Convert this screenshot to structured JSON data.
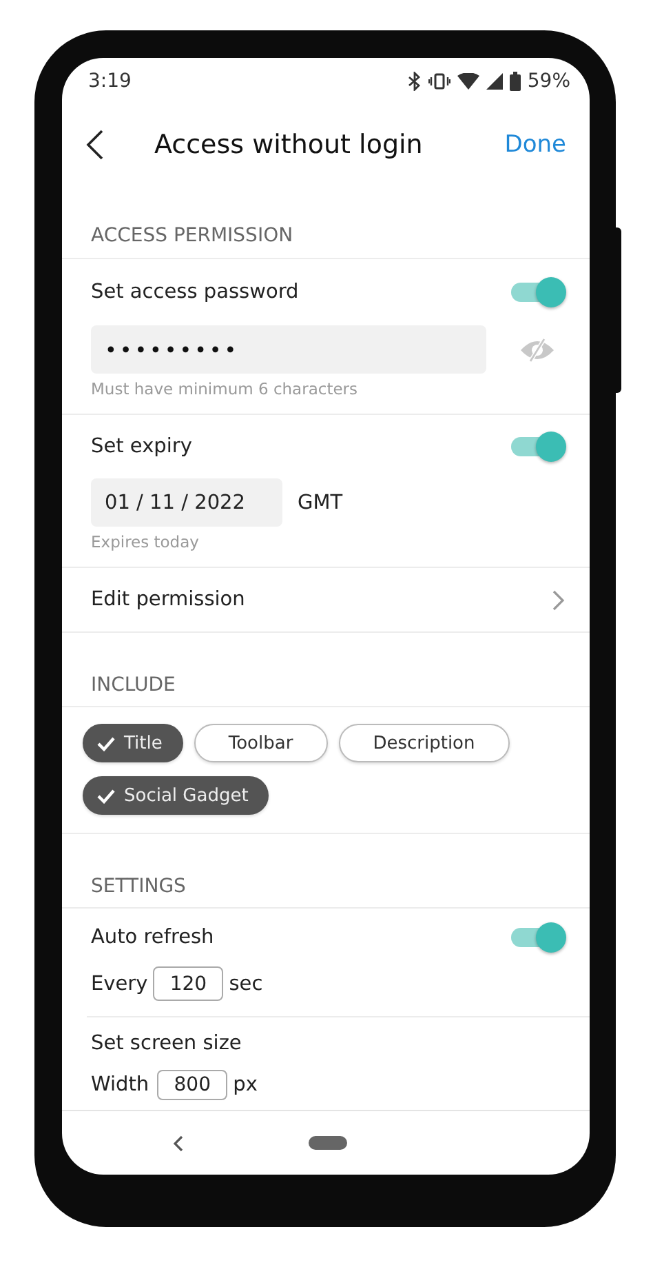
{
  "status_bar": {
    "time": "3:19",
    "battery": "59%"
  },
  "header": {
    "title": "Access without login",
    "done": "Done"
  },
  "access_permission": {
    "heading": "ACCESS PERMISSION",
    "password": {
      "label": "Set access password",
      "on": true,
      "value": "•••••••••",
      "hint": "Must have minimum 6 characters"
    },
    "expiry": {
      "label": "Set expiry",
      "on": true,
      "date": "01 / 11 / 2022",
      "timezone": "GMT",
      "hint": "Expires today"
    },
    "edit_permission": {
      "label": "Edit permission"
    }
  },
  "include": {
    "heading": "INCLUDE",
    "chips": [
      {
        "label": "Title",
        "selected": true
      },
      {
        "label": "Toolbar",
        "selected": false
      },
      {
        "label": "Description",
        "selected": false
      },
      {
        "label": "Social Gadget",
        "selected": true
      }
    ]
  },
  "settings": {
    "heading": "SETTINGS",
    "auto_refresh": {
      "label": "Auto refresh",
      "on": true,
      "prefix": "Every",
      "value": "120",
      "unit": "sec"
    },
    "screen_size": {
      "label": "Set screen size",
      "prefix": "Width",
      "value": "800",
      "unit": "px"
    }
  }
}
